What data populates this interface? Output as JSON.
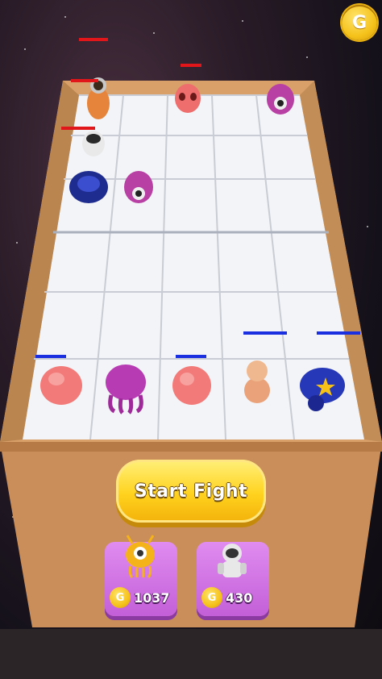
{
  "hud": {
    "coin_symbol": "G"
  },
  "actions": {
    "start_fight_label": "Start Fight"
  },
  "shop": {
    "items": [
      {
        "name": "alien-unit",
        "coin_symbol": "G",
        "price": "1037"
      },
      {
        "name": "astronaut-unit",
        "coin_symbol": "G",
        "price": "430"
      }
    ]
  },
  "board": {
    "rows": 6,
    "cols": 5,
    "enemy_units": [
      "astronaut-orange",
      "pink-alien",
      "purple-eyeball",
      "astronaut-white",
      "blue-brute",
      "purple-eyeball-small"
    ],
    "player_units": [
      "pink-blob",
      "purple-octopus",
      "pink-blob",
      "bald-humanoid",
      "blue-police-brute"
    ]
  },
  "colors": {
    "enemy_health": "#e0161a",
    "player_health": "#1a2fe0",
    "button_yellow": "#ffd21e",
    "shop_purple": "#c35fd8"
  }
}
